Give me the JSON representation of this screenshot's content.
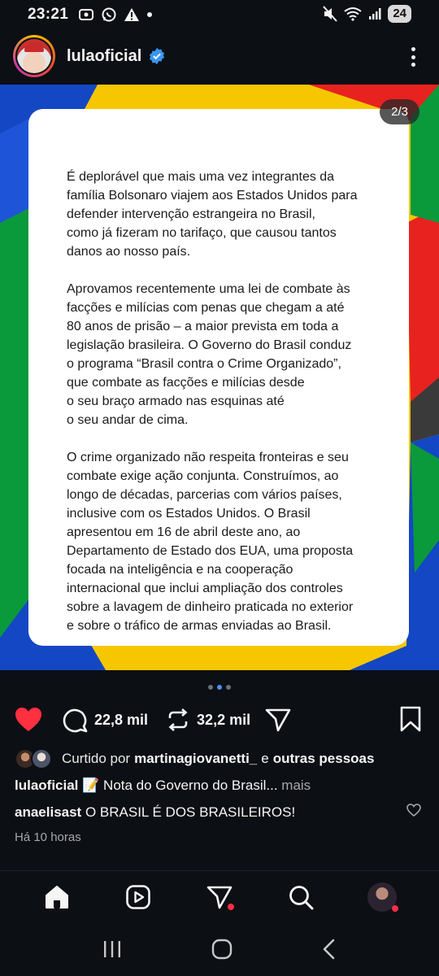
{
  "status_bar": {
    "time": "23:21",
    "battery": "24"
  },
  "post": {
    "username": "lulaoficial",
    "slide_counter": "2/3",
    "card_paragraphs": [
      "É deplorável que mais uma vez integrantes da\nfamília Bolsonaro viajem aos Estados Unidos para\ndefender intervenção estrangeira no Brasil,\ncomo já fizeram no tarifaço, que causou tantos\ndanos ao nosso país.",
      "Aprovamos recentemente uma lei de combate às\nfacções e milícias com penas que chegam a até\n80 anos de prisão – a maior prevista em toda a\nlegislação brasileira. O Governo do Brasil conduz\no programa “Brasil contra o Crime Organizado”,\nque combate as facções e milícias desde\no seu braço armado nas esquinas até\no seu andar de cima.",
      "O crime organizado não respeita fronteiras e seu\ncombate exige ação conjunta. Construímos, ao\nlongo de décadas, parcerias com vários países,\ninclusive com os Estados Unidos. O Brasil\napresentou em 16 de abril deste ano, ao\nDepartamento de Estado dos EUA, uma proposta\nfocada na inteligência e na cooperação\ninternacional que inclui ampliação dos controles\nsobre a lavagem de dinheiro praticada no exterior\ne sobre o tráfico de armas enviadas ao Brasil."
    ],
    "comments_count": "22,8 mil",
    "reposts_count": "32,2 mil",
    "liked_prefix": "Curtido por",
    "liked_by": "martinagiovanetti_",
    "liked_and": "e",
    "liked_others": "outras pessoas",
    "caption_user": "lulaoficial",
    "caption_text": "📝 Nota do Governo do Brasil...",
    "caption_more": "mais",
    "comment_user": "anaelisast",
    "comment_text": "O BRASIL É DOS BRASILEIROS!",
    "time_ago": "Há 10 horas"
  },
  "colors": {
    "like_red": "#ff3040",
    "accent_blue": "#4a90ff",
    "brazil_green": "#0a9a3c",
    "brazil_yellow": "#f6c700",
    "brazil_blue": "#1447c4",
    "red": "#e8221f"
  },
  "icons": [
    "signal-icon",
    "whatsapp-icon",
    "warning-icon",
    "mute-icon",
    "wifi-icon",
    "cell-signal-icon",
    "verified-icon",
    "more-icon",
    "heart-icon",
    "comment-icon",
    "repost-icon",
    "share-icon",
    "bookmark-icon",
    "home-icon",
    "reels-icon",
    "direct-icon",
    "search-icon",
    "recents-icon",
    "home-circle-icon",
    "back-icon"
  ]
}
